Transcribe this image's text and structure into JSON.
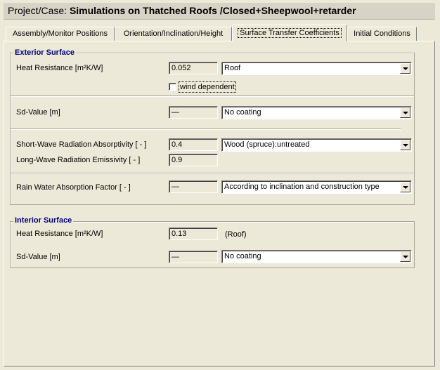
{
  "header": {
    "prefix": "Project/Case:",
    "case_name": "Simulations on Thatched Roofs /Closed+Sheepwool+retarder"
  },
  "tabs": [
    {
      "label": "Assembly/Monitor Positions"
    },
    {
      "label": "Orientation/Inclination/Height"
    },
    {
      "label": "Surface Transfer Coefficients"
    },
    {
      "label": "Initial Conditions"
    }
  ],
  "exterior": {
    "title": "Exterior Surface",
    "heat_resistance": {
      "label": "Heat Resistance [m²K/W]",
      "value": "0.052",
      "combo": "Roof"
    },
    "wind_dependent_label": "wind dependent",
    "sd_value": {
      "label": "Sd-Value  [m]",
      "value": "—",
      "combo": "No coating"
    },
    "short_wave": {
      "label": "Short-Wave Radiation Absorptivity [ - ]",
      "value": "0.4",
      "combo": "Wood (spruce):untreated"
    },
    "long_wave": {
      "label": "Long-Wave Radiation Emissivity [ - ]",
      "value": "0.9"
    },
    "rain": {
      "label": "Rain Water Absorption Factor [ - ]",
      "value": "—",
      "combo": "According to inclination and construction type"
    }
  },
  "interior": {
    "title": "Interior Surface",
    "heat_resistance": {
      "label": "Heat Resistance [m²K/W]",
      "value": "0.13",
      "note": "(Roof)"
    },
    "sd_value": {
      "label": "Sd-Value  [m]",
      "value": "—",
      "combo": "No coating"
    }
  }
}
